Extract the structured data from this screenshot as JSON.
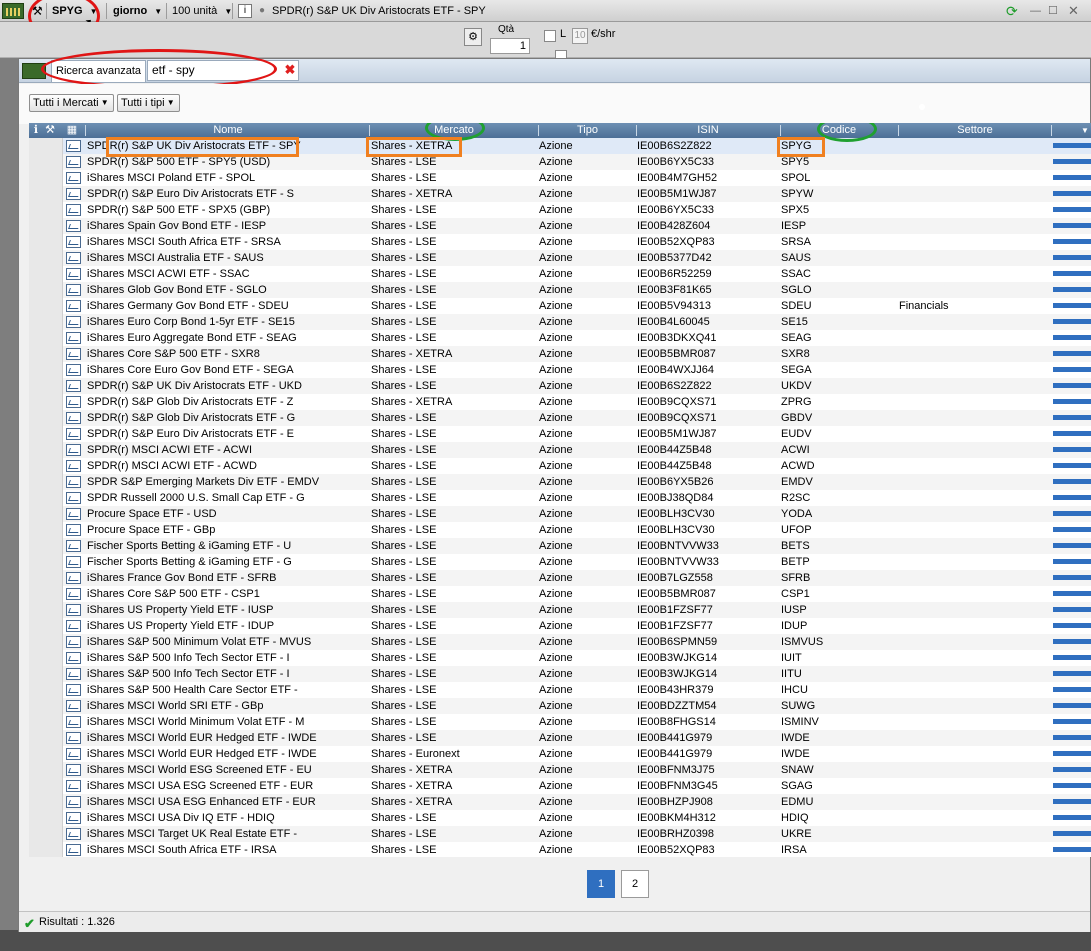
{
  "toolbar": {
    "symbol": "SPYG",
    "period": "giorno",
    "units": "100 unità",
    "info": "i",
    "instrument": "SPDR(r) S&P UK Div Aristocrats ETF - SPY"
  },
  "substrip": {
    "qty_label": "Qtà",
    "qty_value": "1",
    "l_label": "L",
    "price_value": "10",
    "price_unit": "€/shr"
  },
  "dialog": {
    "tab_label": "Ricerca avanzata",
    "search_value": "etf - spy",
    "filters": {
      "markets": "Tutti i Mercati",
      "types": "Tutti i tipi"
    },
    "columns": [
      "Nome",
      "Mercato",
      "Tipo",
      "ISIN",
      "Codice",
      "Settore"
    ],
    "rows": [
      [
        "SPDR(r) S&P UK Div Aristocrats ETF - SPY",
        "Shares - XETRA",
        "Azione",
        "IE00B6S2Z822",
        "SPYG",
        ""
      ],
      [
        "SPDR(r) S&P 500 ETF - SPY5 (USD)",
        "Shares - LSE",
        "Azione",
        "IE00B6YX5C33",
        "SPY5",
        ""
      ],
      [
        "iShares MSCI Poland ETF - SPOL",
        "Shares - LSE",
        "Azione",
        "IE00B4M7GH52",
        "SPOL",
        ""
      ],
      [
        "SPDR(r) S&P Euro Div Aristocrats ETF - S",
        "Shares - XETRA",
        "Azione",
        "IE00B5M1WJ87",
        "SPYW",
        ""
      ],
      [
        "SPDR(r) S&P 500 ETF - SPX5 (GBP)",
        "Shares - LSE",
        "Azione",
        "IE00B6YX5C33",
        "SPX5",
        ""
      ],
      [
        "iShares Spain Gov Bond ETF - IESP",
        "Shares - LSE",
        "Azione",
        "IE00B428Z604",
        "IESP",
        ""
      ],
      [
        "iShares MSCI South Africa ETF - SRSA",
        "Shares - LSE",
        "Azione",
        "IE00B52XQP83",
        "SRSA",
        ""
      ],
      [
        "iShares MSCI Australia ETF - SAUS",
        "Shares - LSE",
        "Azione",
        "IE00B5377D42",
        "SAUS",
        ""
      ],
      [
        "iShares MSCI ACWI ETF - SSAC",
        "Shares - LSE",
        "Azione",
        "IE00B6R52259",
        "SSAC",
        ""
      ],
      [
        "iShares Glob Gov Bond ETF - SGLO",
        "Shares - LSE",
        "Azione",
        "IE00B3F81K65",
        "SGLO",
        ""
      ],
      [
        "iShares Germany Gov Bond ETF - SDEU",
        "Shares - LSE",
        "Azione",
        "IE00B5V94313",
        "SDEU",
        "Financials"
      ],
      [
        "iShares Euro Corp Bond 1-5yr ETF - SE15",
        "Shares - LSE",
        "Azione",
        "IE00B4L60045",
        "SE15",
        ""
      ],
      [
        "iShares Euro Aggregate Bond ETF - SEAG",
        "Shares - LSE",
        "Azione",
        "IE00B3DKXQ41",
        "SEAG",
        ""
      ],
      [
        "iShares Core S&P 500 ETF - SXR8",
        "Shares - XETRA",
        "Azione",
        "IE00B5BMR087",
        "SXR8",
        ""
      ],
      [
        "iShares Core Euro Gov Bond ETF - SEGA",
        "Shares - LSE",
        "Azione",
        "IE00B4WXJJ64",
        "SEGA",
        ""
      ],
      [
        "SPDR(r) S&P UK Div Aristocrats ETF - UKD",
        "Shares - LSE",
        "Azione",
        "IE00B6S2Z822",
        "UKDV",
        ""
      ],
      [
        "SPDR(r) S&P Glob Div Aristocrats ETF - Z",
        "Shares - XETRA",
        "Azione",
        "IE00B9CQXS71",
        "ZPRG",
        ""
      ],
      [
        "SPDR(r) S&P Glob Div Aristocrats ETF - G",
        "Shares - LSE",
        "Azione",
        "IE00B9CQXS71",
        "GBDV",
        ""
      ],
      [
        "SPDR(r) S&P Euro Div Aristocrats ETF - E",
        "Shares - LSE",
        "Azione",
        "IE00B5M1WJ87",
        "EUDV",
        ""
      ],
      [
        "SPDR(r) MSCI ACWI ETF - ACWI",
        "Shares - LSE",
        "Azione",
        "IE00B44Z5B48",
        "ACWI",
        ""
      ],
      [
        "SPDR(r) MSCI ACWI ETF - ACWD",
        "Shares - LSE",
        "Azione",
        "IE00B44Z5B48",
        "ACWD",
        ""
      ],
      [
        "SPDR S&P Emerging Markets Div ETF - EMDV",
        "Shares - LSE",
        "Azione",
        "IE00B6YX5B26",
        "EMDV",
        ""
      ],
      [
        "SPDR Russell 2000 U.S. Small Cap ETF - G",
        "Shares - LSE",
        "Azione",
        "IE00BJ38QD84",
        "R2SC",
        ""
      ],
      [
        "Procure Space ETF - USD",
        "Shares - LSE",
        "Azione",
        "IE00BLH3CV30",
        "YODA",
        ""
      ],
      [
        "Procure Space ETF - GBp",
        "Shares - LSE",
        "Azione",
        "IE00BLH3CV30",
        "UFOP",
        ""
      ],
      [
        "Fischer Sports Betting & iGaming ETF - U",
        "Shares - LSE",
        "Azione",
        "IE00BNTVVW33",
        "BETS",
        ""
      ],
      [
        "Fischer Sports Betting & iGaming ETF - G",
        "Shares - LSE",
        "Azione",
        "IE00BNTVVW33",
        "BETP",
        ""
      ],
      [
        "iShares France Gov Bond ETF - SFRB",
        "Shares - LSE",
        "Azione",
        "IE00B7LGZ558",
        "SFRB",
        ""
      ],
      [
        "iShares Core S&P 500 ETF - CSP1",
        "Shares - LSE",
        "Azione",
        "IE00B5BMR087",
        "CSP1",
        ""
      ],
      [
        "iShares US Property Yield ETF - IUSP",
        "Shares - LSE",
        "Azione",
        "IE00B1FZSF77",
        "IUSP",
        ""
      ],
      [
        "iShares US Property Yield ETF - IDUP",
        "Shares - LSE",
        "Azione",
        "IE00B1FZSF77",
        "IDUP",
        ""
      ],
      [
        "iShares S&P 500 Minimum Volat ETF - MVUS",
        "Shares - LSE",
        "Azione",
        "IE00B6SPMN59",
        "ISMVUS",
        ""
      ],
      [
        "iShares S&P 500 Info Tech Sector ETF - I",
        "Shares - LSE",
        "Azione",
        "IE00B3WJKG14",
        "IUIT",
        ""
      ],
      [
        "iShares S&P 500 Info Tech Sector ETF - I",
        "Shares - LSE",
        "Azione",
        "IE00B3WJKG14",
        "IITU",
        ""
      ],
      [
        "iShares S&P 500 Health Care Sector ETF -",
        "Shares - LSE",
        "Azione",
        "IE00B43HR379",
        "IHCU",
        ""
      ],
      [
        "iShares MSCI World SRI ETF - GBp",
        "Shares - LSE",
        "Azione",
        "IE00BDZZTM54",
        "SUWG",
        ""
      ],
      [
        "iShares MSCI World Minimum Volat ETF - M",
        "Shares - LSE",
        "Azione",
        "IE00B8FHGS14",
        "ISMINV",
        ""
      ],
      [
        "iShares MSCI World EUR Hedged ETF - IWDE",
        "Shares - LSE",
        "Azione",
        "IE00B441G979",
        "IWDE",
        ""
      ],
      [
        "iShares MSCI World EUR Hedged ETF - IWDE",
        "Shares - Euronext",
        "Azione",
        "IE00B441G979",
        "IWDE",
        ""
      ],
      [
        "iShares MSCI World ESG Screened ETF - EU",
        "Shares - XETRA",
        "Azione",
        "IE00BFNM3J75",
        "SNAW",
        ""
      ],
      [
        "iShares MSCI USA ESG Screened ETF - EUR",
        "Shares - XETRA",
        "Azione",
        "IE00BFNM3G45",
        "SGAG",
        ""
      ],
      [
        "iShares MSCI USA ESG Enhanced ETF - EUR",
        "Shares - XETRA",
        "Azione",
        "IE00BHZPJ908",
        "EDMU",
        ""
      ],
      [
        "iShares MSCI USA Div IQ ETF - HDIQ",
        "Shares - LSE",
        "Azione",
        "IE00BKM4H312",
        "HDIQ",
        ""
      ],
      [
        "iShares MSCI Target UK Real Estate ETF -",
        "Shares - LSE",
        "Azione",
        "IE00BRHZ0398",
        "UKRE",
        ""
      ],
      [
        "iShares MSCI South Africa ETF - IRSA",
        "Shares - LSE",
        "Azione",
        "IE00B52XQP83",
        "IRSA",
        ""
      ]
    ],
    "pages": [
      "1",
      "2"
    ],
    "status": "Risultati : 1.326"
  },
  "colors": {
    "header": "#4c6f96",
    "accent": "#2f6fc0",
    "annotation_red": "#e01515",
    "annotation_green": "#1fa030",
    "annotation_orange": "#f08020"
  }
}
